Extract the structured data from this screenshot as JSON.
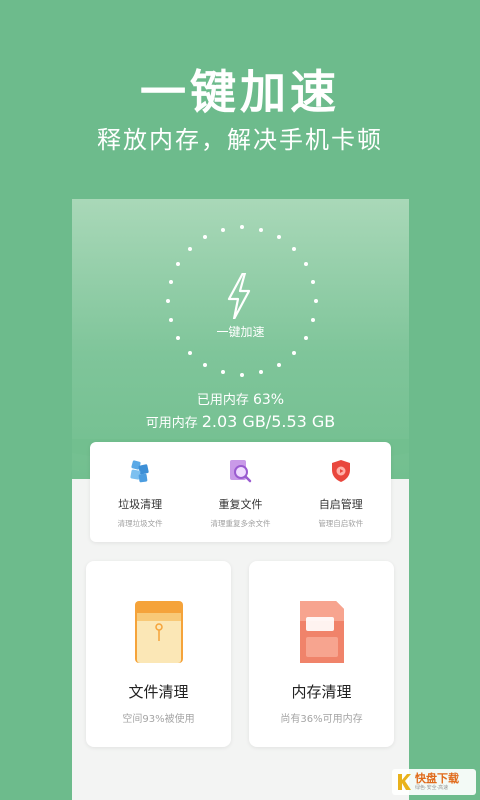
{
  "header": {
    "title": "一键加速",
    "subtitle": "释放内存，解决手机卡顿"
  },
  "phone": {
    "boost_button_label": "一键加速",
    "memory_used_label": "已用内存",
    "memory_used_percent": "63%",
    "memory_available_label": "可用内存",
    "memory_available_value": "2.03 GB/5.53 GB",
    "tools": [
      {
        "title": "垃圾清理",
        "desc": "清理垃圾文件",
        "icon": "trash-cubes-icon"
      },
      {
        "title": "重复文件",
        "desc": "清理重复多余文件",
        "icon": "search-file-icon"
      },
      {
        "title": "自启管理",
        "desc": "管理自启软件",
        "icon": "shield-icon"
      }
    ]
  },
  "cards": {
    "file_clean": {
      "title": "文件清理",
      "desc": "空间93%被使用",
      "icon": "folder-icon"
    },
    "memory_clean": {
      "title": "内存清理",
      "desc": "尚有36%可用内存",
      "icon": "sd-card-icon"
    }
  },
  "watermark": {
    "main": "快盘下载",
    "sub": "绿色·安全·高速"
  },
  "colors": {
    "background": "#6dbb8c",
    "accent_orange": "#f5a33a",
    "watermark_orange": "#e06a1a"
  }
}
